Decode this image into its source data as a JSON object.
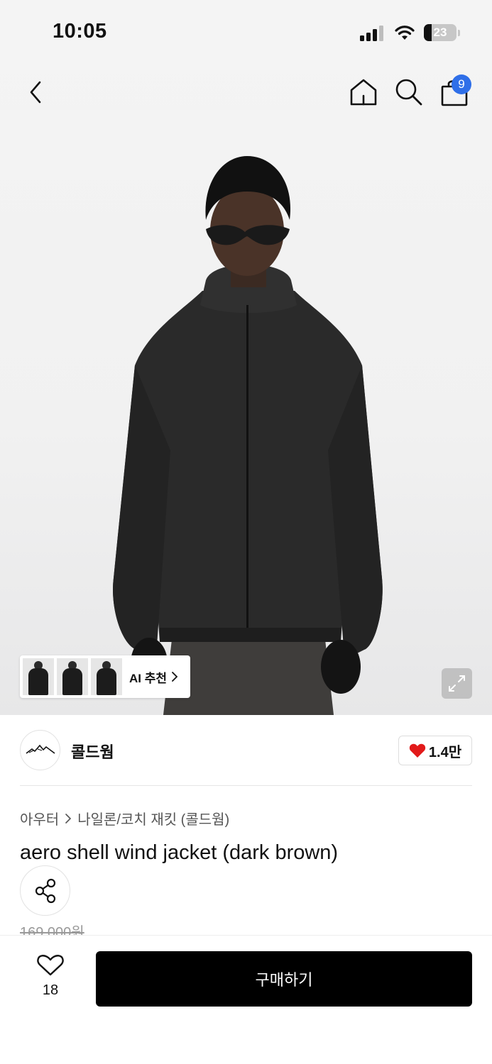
{
  "status_bar": {
    "time": "10:05",
    "battery": "23",
    "icons": [
      "signal-icon",
      "wifi-icon",
      "battery-icon"
    ]
  },
  "nav": {
    "icons": [
      "back-icon",
      "home-icon",
      "search-icon",
      "shopping-bag-icon"
    ],
    "cart_count": "9",
    "badge_color": "#2f6fe8"
  },
  "gallery": {
    "ai_recommend_label": "AI 추천",
    "thumbnail_count": 3,
    "expand_icon": "expand-icon"
  },
  "brand": {
    "name": "콜드웜",
    "likes": "1.4만",
    "heart_color": "#e21a1a"
  },
  "product": {
    "breadcrumb": [
      "아우터",
      "나일론/코치 재킷 (콜드웜)"
    ],
    "title": "aero shell wind jacket (dark brown)",
    "price": "169,000원"
  },
  "bottom_bar": {
    "wish_count": "18",
    "buy_label": "구매하기"
  }
}
